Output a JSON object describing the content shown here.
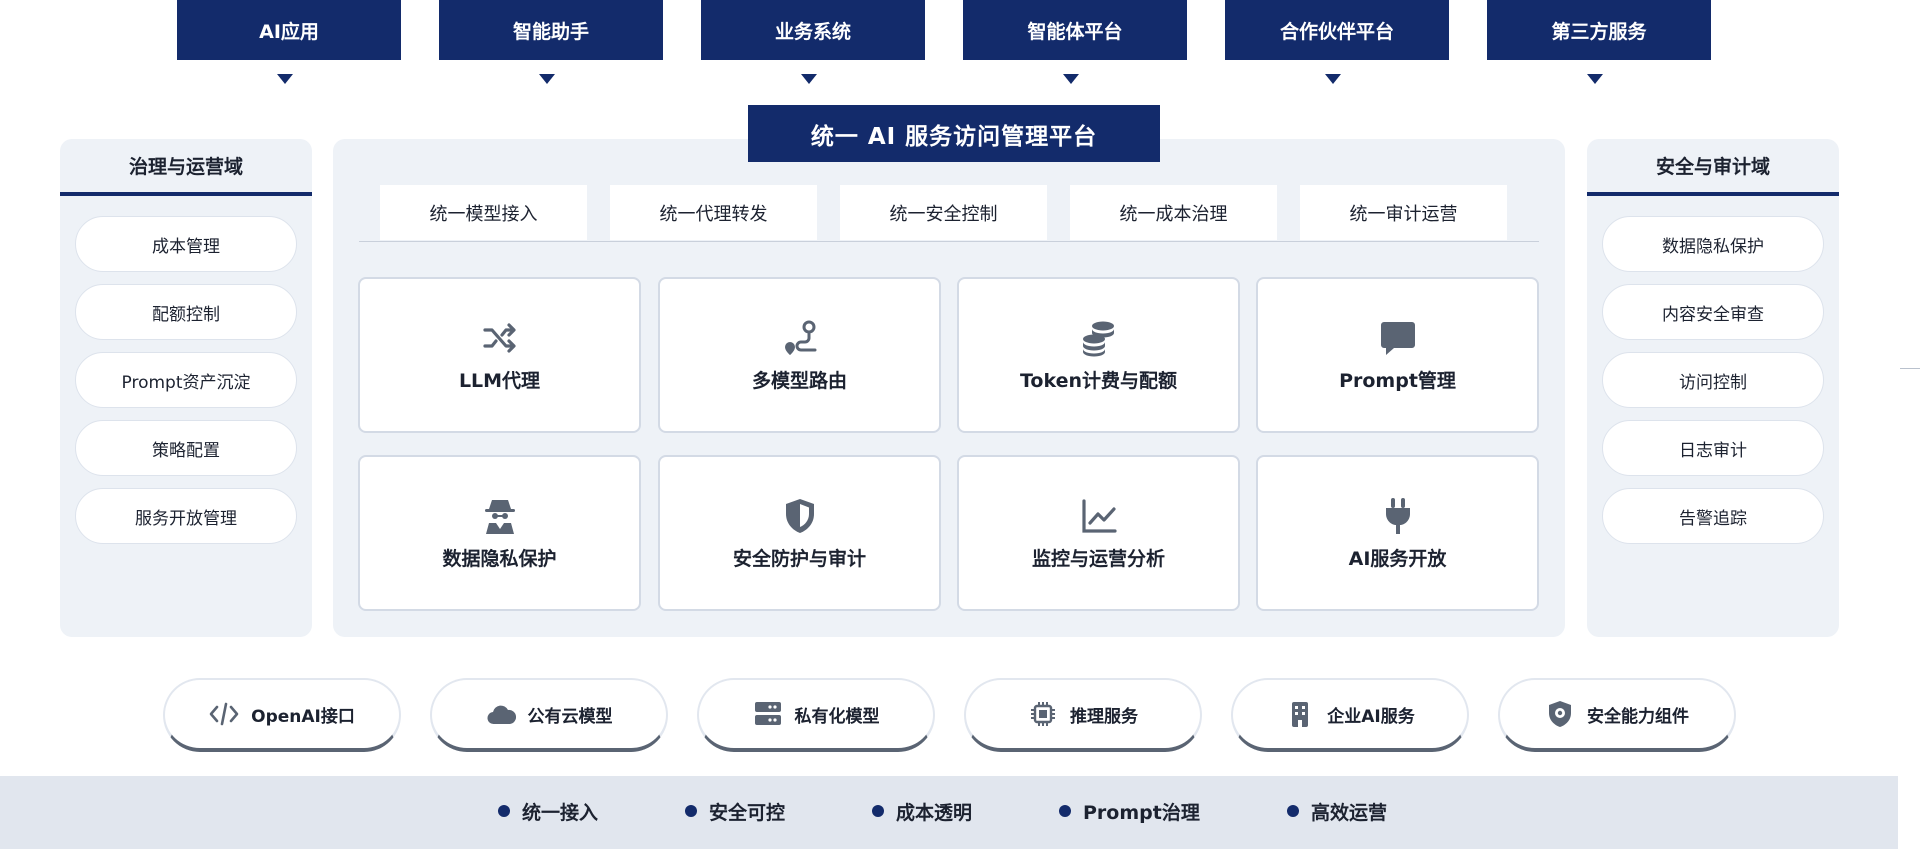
{
  "top_consumers": [
    "AI应用",
    "智能助手",
    "业务系统",
    "智能体平台",
    "合作伙伴平台",
    "第三方服务"
  ],
  "platform": {
    "title": "统一 AI 服务访问管理平台",
    "tabs": [
      "统一模型接入",
      "统一代理转发",
      "统一安全控制",
      "统一成本治理",
      "统一审计运营"
    ],
    "capabilities": [
      {
        "label": "LLM代理",
        "icon": "shuffle-icon"
      },
      {
        "label": "多模型路由",
        "icon": "route-icon"
      },
      {
        "label": "Token计费与配额",
        "icon": "coins-icon"
      },
      {
        "label": "Prompt管理",
        "icon": "chat-bubble-icon"
      },
      {
        "label": "数据隐私保护",
        "icon": "user-secret-icon"
      },
      {
        "label": "安全防护与审计",
        "icon": "shield-icon"
      },
      {
        "label": "监控与运营分析",
        "icon": "line-chart-icon"
      },
      {
        "label": "AI服务开放",
        "icon": "plug-icon"
      }
    ]
  },
  "governance": {
    "title": "治理与运营域",
    "items": [
      "成本管理",
      "配额控制",
      "Prompt资产沉淀",
      "策略配置",
      "服务开放管理"
    ]
  },
  "security": {
    "title": "安全与审计域",
    "items": [
      "数据隐私保护",
      "内容安全审查",
      "访问控制",
      "日志审计",
      "告警追踪"
    ]
  },
  "providers": [
    {
      "label": "OpenAI接口",
      "icon": "code-icon"
    },
    {
      "label": "公有云模型",
      "icon": "cloud-icon"
    },
    {
      "label": "私有化模型",
      "icon": "server-icon"
    },
    {
      "label": "推理服务",
      "icon": "chip-icon"
    },
    {
      "label": "企业AI服务",
      "icon": "building-icon"
    },
    {
      "label": "安全能力组件",
      "icon": "shield-gear-icon"
    }
  ],
  "features": [
    "统一接入",
    "安全可控",
    "成本透明",
    "Prompt治理",
    "高效运营"
  ],
  "colors": {
    "navy": "#132b6b",
    "panel": "#eef2f7",
    "icon": "#5a6473",
    "footer": "#e1e6ee"
  }
}
